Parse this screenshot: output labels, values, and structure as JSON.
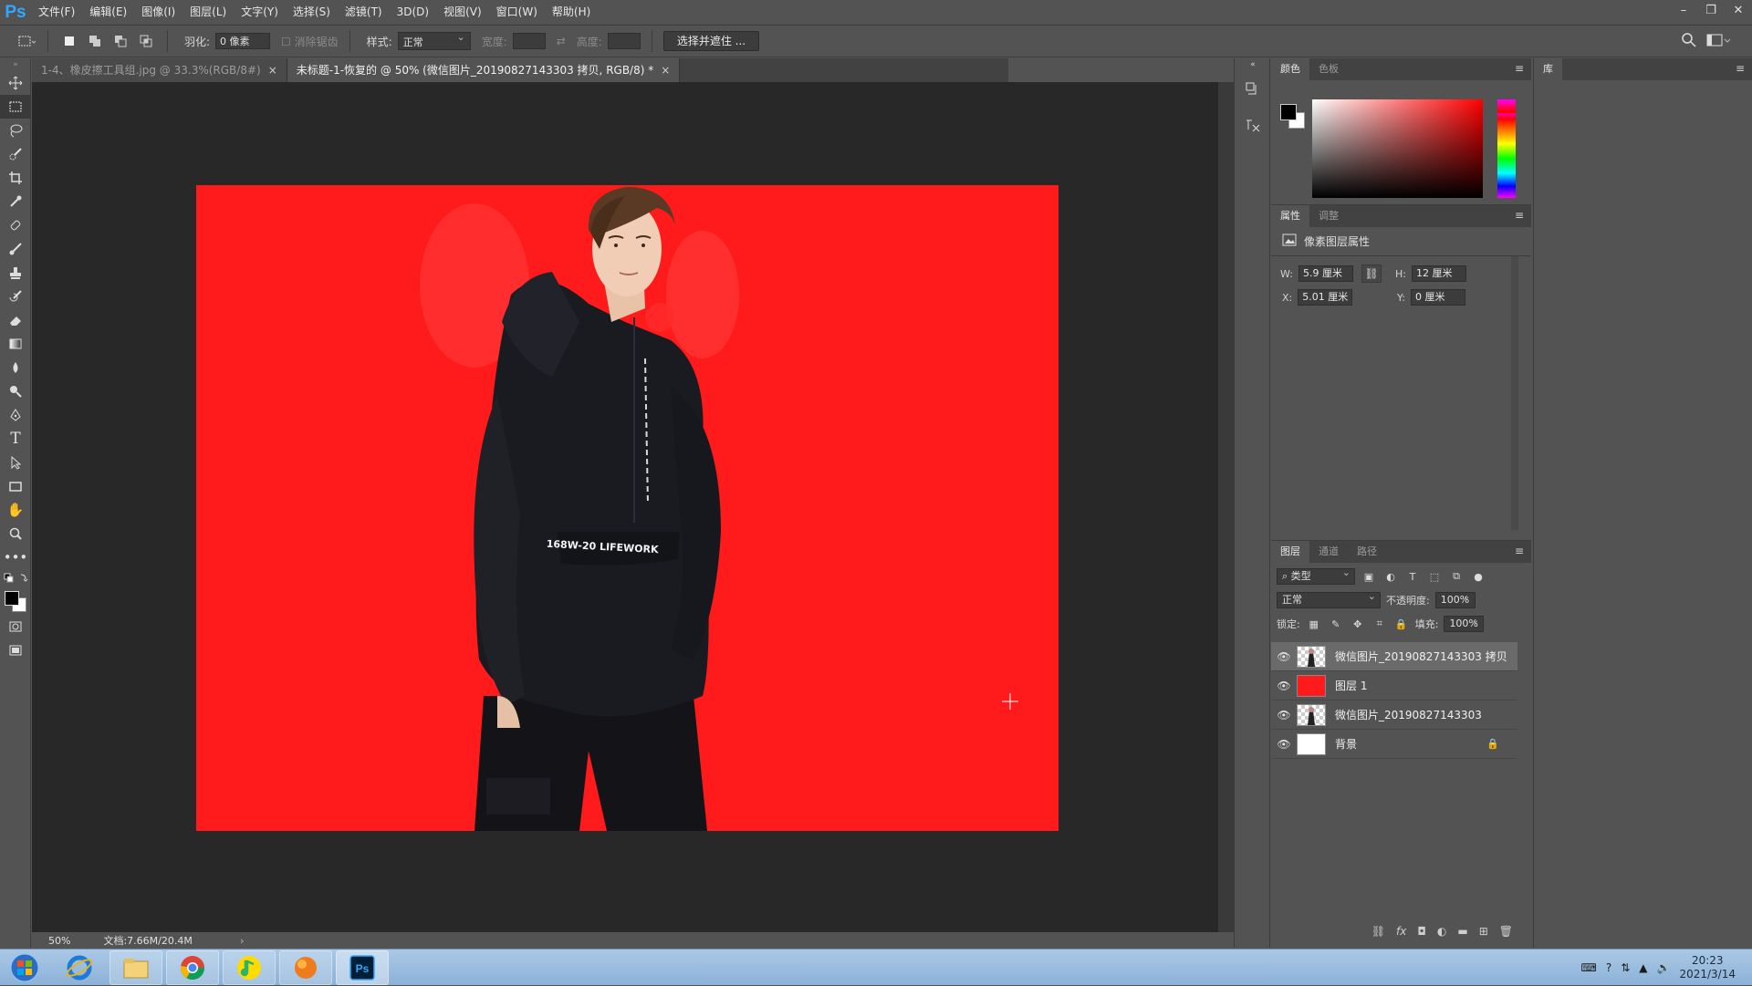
{
  "app": {
    "logo": "Ps"
  },
  "menu": [
    "文件(F)",
    "编辑(E)",
    "图像(I)",
    "图层(L)",
    "文字(Y)",
    "选择(S)",
    "滤镜(T)",
    "3D(D)",
    "视图(V)",
    "窗口(W)",
    "帮助(H)"
  ],
  "options": {
    "feather_label": "羽化:",
    "feather_value": "0 像素",
    "antialias_label": "消除锯齿",
    "style_label": "样式:",
    "style_value": "正常",
    "width_label": "宽度:",
    "height_label": "高度:",
    "mask_button": "选择并遮住 ..."
  },
  "tabs": [
    {
      "label": "1-4、橡皮擦工具组.jpg @ 33.3%(RGB/8#)",
      "active": false
    },
    {
      "label": "未标题-1-恢复的 @ 50% (微信图片_20190827143303 拷贝, RGB/8) *",
      "active": true
    }
  ],
  "status": {
    "zoom": "50%",
    "doc": "文档:7.66M/20.4M"
  },
  "color_panel": {
    "tabs": [
      "颜色",
      "色板"
    ],
    "fg": "#000000",
    "bg": "#ffffff"
  },
  "library_panel": {
    "tab": "库"
  },
  "properties": {
    "tabs": [
      "属性",
      "调整"
    ],
    "header": "像素图层属性",
    "w_label": "W:",
    "w_value": "5.9 厘米",
    "h_label": "H:",
    "h_value": "12 厘米",
    "x_label": "X:",
    "x_value": "5.01 厘米",
    "y_label": "Y:",
    "y_value": "0 厘米"
  },
  "layers_panel": {
    "tabs": [
      "图层",
      "通道",
      "路径"
    ],
    "filter_kind": "类型",
    "blend_mode": "正常",
    "opacity_label": "不透明度:",
    "opacity_value": "100%",
    "lock_label": "锁定:",
    "fill_label": "填充:",
    "fill_value": "100%",
    "layers": [
      {
        "name": "微信图片_20190827143303 拷贝",
        "thumb": "photo-transparent",
        "selected": true,
        "locked": false
      },
      {
        "name": "图层 1",
        "thumb": "red",
        "selected": false,
        "locked": false
      },
      {
        "name": "微信图片_20190827143303",
        "thumb": "photo-transparent",
        "selected": false,
        "locked": false
      },
      {
        "name": "背景",
        "thumb": "white",
        "selected": false,
        "locked": true
      }
    ]
  },
  "canvas": {
    "background_color": "#ff1b1b",
    "jacket_text": "168W-20 LIFEWORK"
  },
  "taskbar": {
    "apps": [
      "ie-icon",
      "explorer-icon",
      "chrome-icon",
      "qqmusic-icon",
      "app-orange-icon",
      "photoshop-icon"
    ],
    "time": "20:23",
    "date": "2021/3/14"
  }
}
